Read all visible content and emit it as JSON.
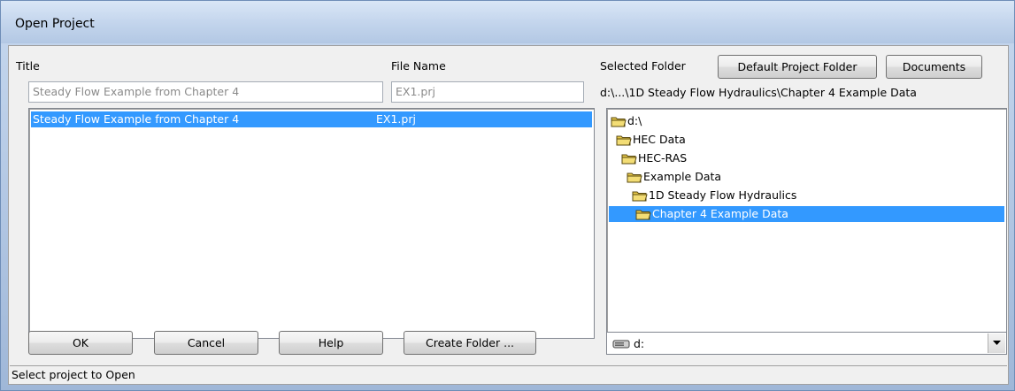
{
  "window": {
    "title": "Open Project"
  },
  "labels": {
    "title": "Title",
    "file_name": "File Name",
    "selected_folder": "Selected Folder"
  },
  "fields": {
    "title_value": "Steady Flow Example from Chapter 4",
    "file_name_value": "EX1.prj"
  },
  "buttons": {
    "default_project_folder": "Default Project Folder",
    "documents": "Documents",
    "ok": "OK",
    "cancel": "Cancel",
    "help": "Help",
    "create_folder": "Create Folder ..."
  },
  "selected_folder_path": "d:\\...\\1D Steady Flow Hydraulics\\Chapter 4 Example Data",
  "project_list": [
    {
      "title": "Steady Flow Example from Chapter 4",
      "file": "EX1.prj",
      "selected": true
    }
  ],
  "folder_tree": [
    {
      "label": "d:\\",
      "selected": false,
      "icon": "open-folder-icon"
    },
    {
      "label": "HEC Data",
      "selected": false,
      "icon": "open-folder-icon"
    },
    {
      "label": "HEC-RAS",
      "selected": false,
      "icon": "open-folder-icon"
    },
    {
      "label": "Example Data",
      "selected": false,
      "icon": "open-folder-icon"
    },
    {
      "label": "1D Steady Flow Hydraulics",
      "selected": false,
      "icon": "open-folder-icon"
    },
    {
      "label": "Chapter 4 Example Data",
      "selected": true,
      "icon": "open-folder-icon"
    }
  ],
  "drive_combo": {
    "value": "d:",
    "icon": "drive-icon"
  },
  "status": {
    "text": "Select project to Open"
  },
  "colors": {
    "selection": "#3399ff",
    "folder": "#e8c94a"
  }
}
